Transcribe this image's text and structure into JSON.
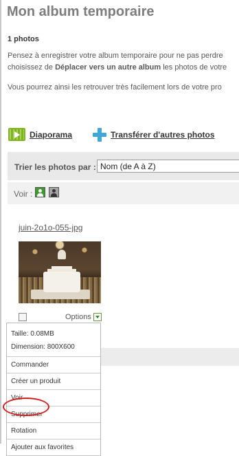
{
  "page": {
    "title": "Mon album temporaire",
    "photo_count": "1 photos",
    "info_line1": "Pensez à enregistrer votre album temporaire pour ne pas perdre",
    "info_line2_prefix": "choisissez de ",
    "info_line2_bold": "Déplacer vers un autre album",
    "info_line2_suffix": " les photos de votre",
    "info_line3": "Vous pourrez ainsi les retrouver très facilement lors de votre pro"
  },
  "actions": {
    "slideshow_label": "Diaporama",
    "slideshow_icon": "film-play-icon",
    "transfer_label": "Transférer d'autres photos",
    "transfer_icon": "plus-icon"
  },
  "sort": {
    "label": "Trier les photos par :",
    "selected": "Nom (de A à Z)"
  },
  "view": {
    "label": "Voir :",
    "icons": [
      "person-icon-green",
      "person-icon-grey"
    ]
  },
  "photo": {
    "name": "juin-2o1o-055-jpg",
    "options_label": "Options",
    "checked": false
  },
  "menu": {
    "size_line": "Taille: 0.08MB",
    "dimension_line": "Dimension: 800X600",
    "items": [
      "Commander",
      "Créer un produit",
      "Voir",
      "Supprimer",
      "Rotation",
      "Ajouter aux favorites"
    ]
  },
  "colors": {
    "accent_green": "#7fb51c",
    "accent_blue": "#3fa8d8",
    "highlight_red": "#d11f1f"
  }
}
